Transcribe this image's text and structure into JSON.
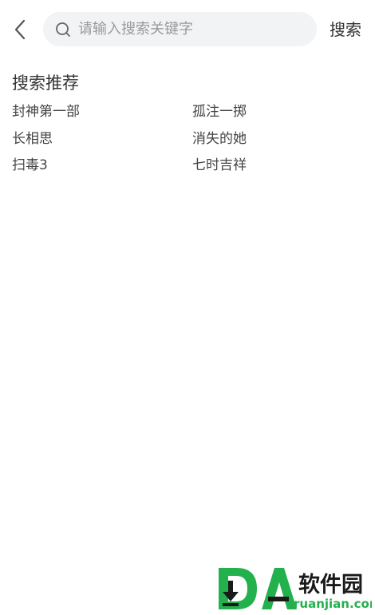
{
  "search": {
    "placeholder": "请输入搜索关键字",
    "value": "",
    "button_label": "搜索"
  },
  "recommend": {
    "title": "搜索推荐",
    "items": [
      {
        "label": "封神第一部"
      },
      {
        "label": "孤注一掷"
      },
      {
        "label": "长相思"
      },
      {
        "label": "消失的她"
      },
      {
        "label": "扫毒3"
      },
      {
        "label": "七时吉祥"
      }
    ]
  },
  "watermark": {
    "brand": "软件园",
    "url": "ruanjian.com"
  },
  "colors": {
    "watermark_green": "#22b14c",
    "search_bg": "#f2f3f5"
  },
  "icons": {
    "back": "chevron-left-icon",
    "search": "search-icon"
  }
}
